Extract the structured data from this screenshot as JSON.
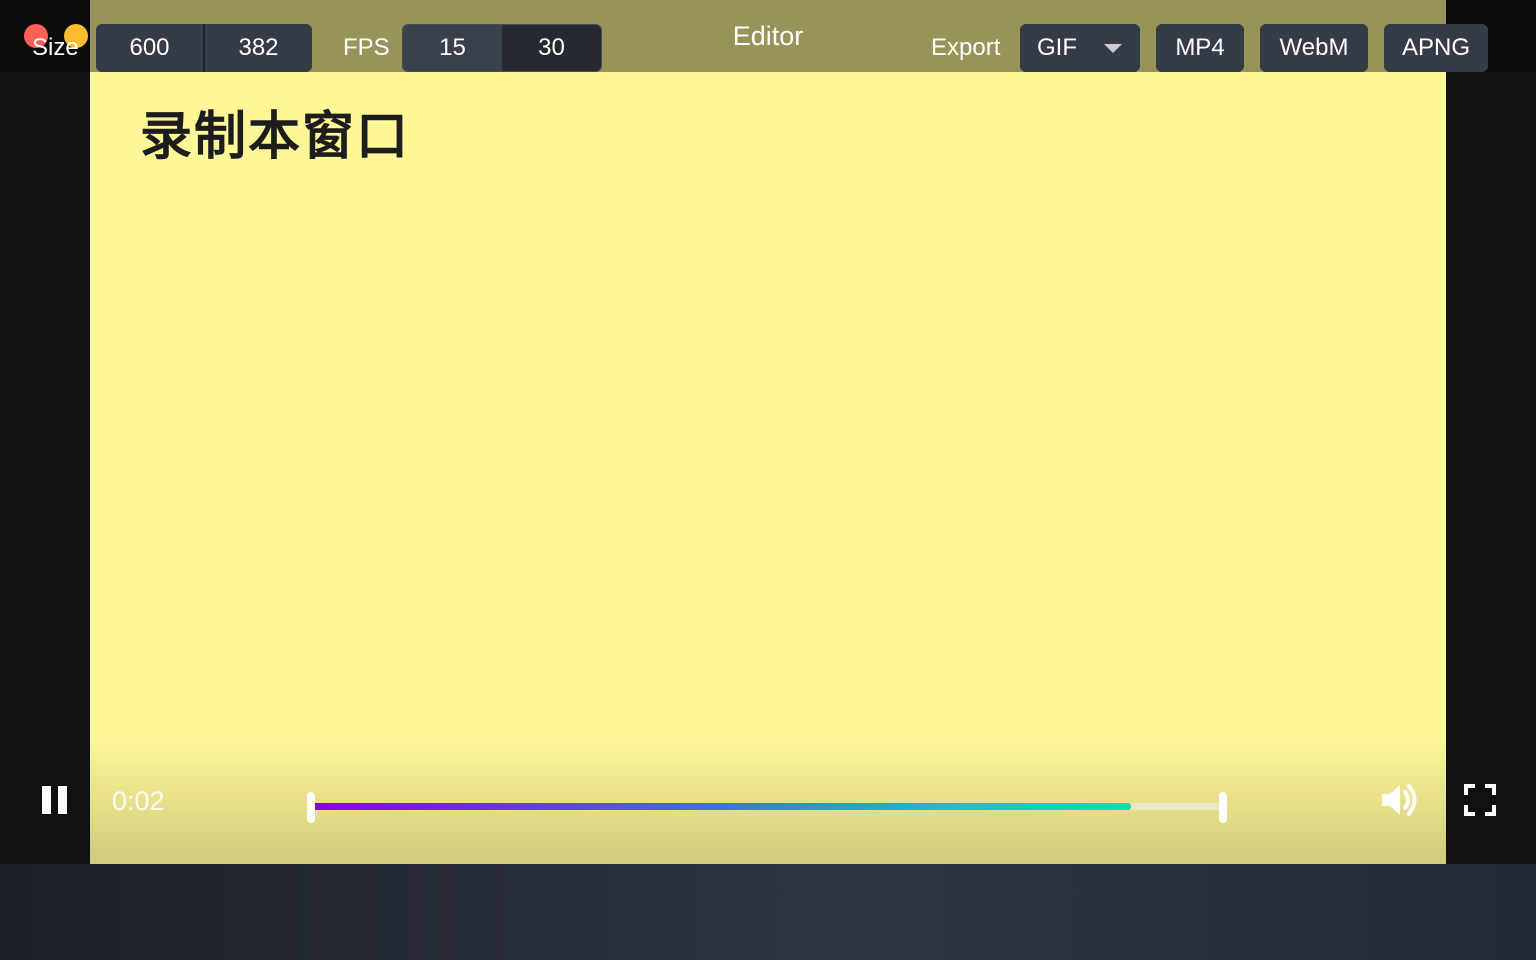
{
  "window": {
    "title": "Editor",
    "controls": [
      "close",
      "minimize",
      "maximize"
    ]
  },
  "preview": {
    "text": "录制本窗口",
    "background": "#fdf798"
  },
  "player": {
    "time": "0:02",
    "progress": 0.9,
    "icons": {
      "play_pause": "pause-icon",
      "volume": "volume-icon",
      "fullscreen": "fullscreen-icon"
    },
    "gradient": [
      "#8a00f0",
      "#00e6a2"
    ]
  },
  "toolbar": {
    "size_label": "Size",
    "width": "600",
    "height": "382",
    "fps_label": "FPS",
    "fps_options": [
      "15",
      "30"
    ],
    "fps_selected": "15",
    "export_label": "Export",
    "formats": {
      "gif": "GIF",
      "mp4": "MP4",
      "webm": "WebM",
      "apng": "APNG"
    }
  }
}
